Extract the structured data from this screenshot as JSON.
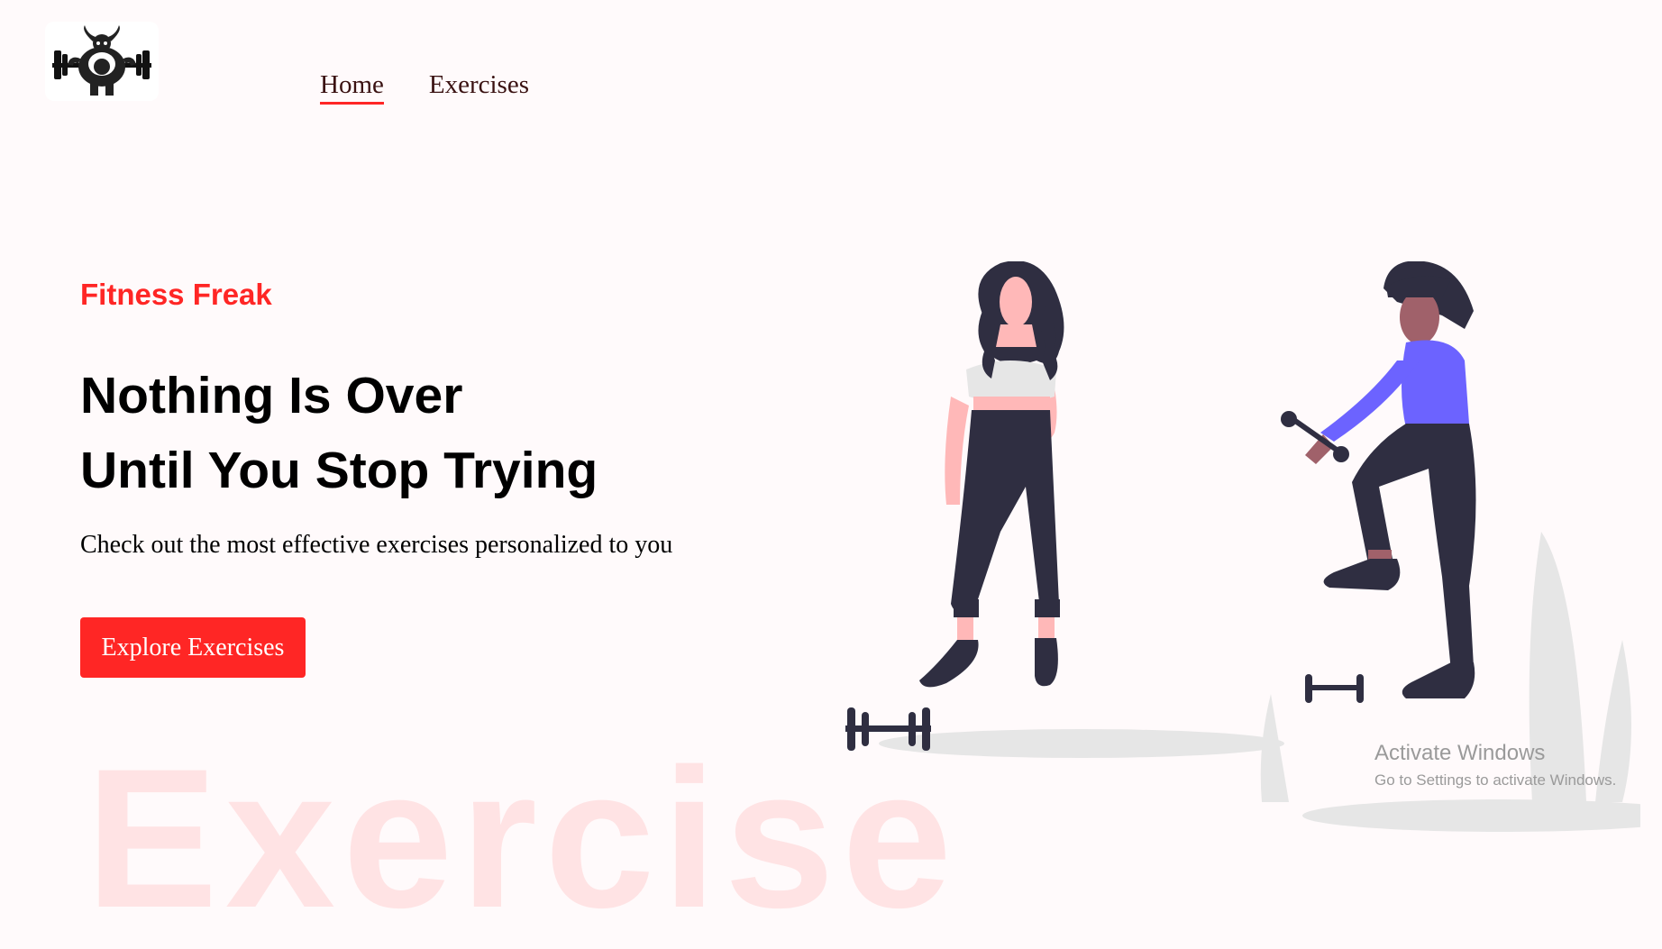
{
  "nav": {
    "items": [
      {
        "label": "Home",
        "active": true
      },
      {
        "label": "Exercises",
        "active": false
      }
    ]
  },
  "hero": {
    "subtitle": "Fitness Freak",
    "headline_line1": "Nothing Is Over",
    "headline_line2": "Until You Stop Trying",
    "description": "Check out the most effective exercises personalized to you",
    "cta_label": "Explore Exercises",
    "watermark": "Exercise"
  },
  "system_overlay": {
    "line1": "Activate Windows",
    "line2": "Go to Settings to activate Windows."
  },
  "colors": {
    "accent": "#ff2625",
    "background": "#fffafb",
    "nav_text": "#3a1212",
    "pants": "#2f2e41",
    "top": "#6c63ff",
    "skin_light": "#ffb8b8",
    "skin_dark": "#a0616a"
  },
  "icons": {
    "logo": "bull-lifting-barbell-logo"
  }
}
